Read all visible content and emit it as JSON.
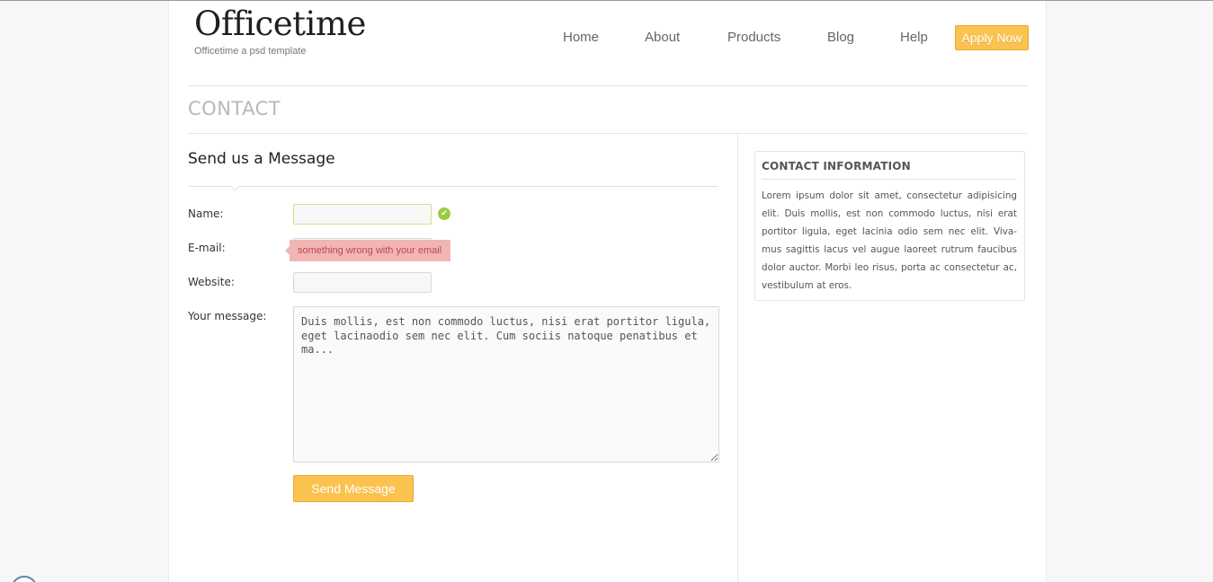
{
  "header": {
    "logo_title": "Officetime",
    "logo_subtitle": "Officetime a psd template",
    "nav": [
      {
        "label": "Home"
      },
      {
        "label": "About"
      },
      {
        "label": "Products"
      },
      {
        "label": "Blog"
      },
      {
        "label": "Help"
      }
    ],
    "apply_label": "Apply Now"
  },
  "page": {
    "heading": "CONTACT"
  },
  "form": {
    "title": "Send us a Message",
    "name_label": "Name:",
    "name_value": "",
    "email_label": "E-mail:",
    "email_value": "",
    "email_error": "something wrong with your email",
    "website_label": "Website:",
    "website_value": "",
    "message_label": "Your message:",
    "message_value": "Duis mollis, est non commodo luctus, nisi erat portitor ligula, eget lacinaodio sem nec elit. Cum sociis natoque penatibus et ma...",
    "submit_label": "Send Message"
  },
  "sidebar": {
    "title": "CONTACT INFORMATION",
    "body": "Lorem ipsum dolor sit amet, consectetur adipisicing elit. Duis mollis, est non commodo luctus, nisi erat portitor ligula, eget lacinia odio sem nec elit. Viva-mus sagittis lacus vel augue laoreet rutrum faucibus dolor auctor. Morbi leo risus, porta ac consectetur ac, vestibulum at eros."
  },
  "colors": {
    "accent": "#fbc24f",
    "error_bg": "#f2b5b5",
    "valid": "#9ccb44"
  },
  "icons": {
    "name_valid": "check-circle-icon"
  }
}
